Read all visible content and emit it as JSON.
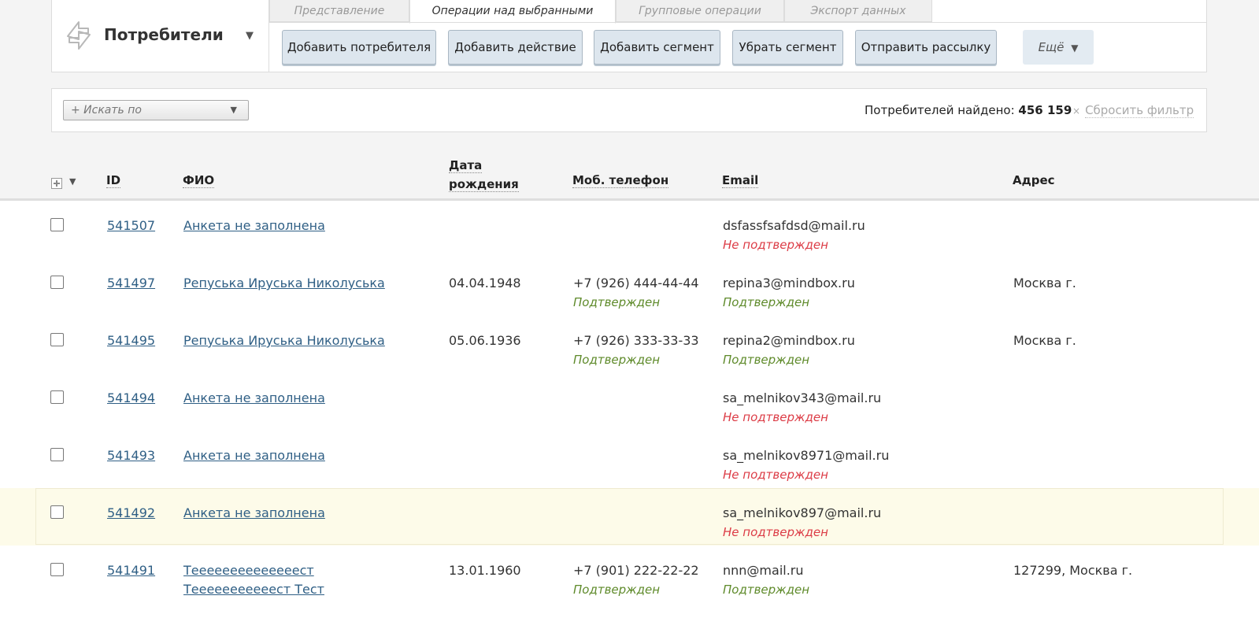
{
  "app": {
    "title": "Потребители"
  },
  "tabs": [
    {
      "label": "Представление",
      "active": false
    },
    {
      "label": "Операции над выбранными",
      "active": true
    },
    {
      "label": "Групповые операции",
      "active": false
    },
    {
      "label": "Экспорт данных",
      "active": false
    }
  ],
  "actions": {
    "add_customer": "Добавить потребителя",
    "add_action": "Добавить действие",
    "add_segment": "Добавить сегмент",
    "remove_segment": "Убрать сегмент",
    "send_mailing": "Отправить рассылку",
    "more": "Ещё"
  },
  "filter": {
    "search_placeholder": "+ Искать по",
    "found_label": "Потребителей найдено:",
    "found_count": "456 159",
    "reset_label": "Сбросить фильтр"
  },
  "columns": {
    "id": "ID",
    "name": "ФИО",
    "birth_line1": "Дата",
    "birth_line2": "рождения",
    "phone": "Моб. телефон",
    "email": "Email",
    "address": "Адрес"
  },
  "rows": [
    {
      "id": "541507",
      "name1": "Анкета не заполнена",
      "name2": "",
      "birth": "",
      "phone": "",
      "phone_status": "",
      "phone_ok": true,
      "email": "dsfassfsafdsd@mail.ru",
      "email_status": "Не подтвержден",
      "email_ok": false,
      "address": "",
      "highlighted": false
    },
    {
      "id": "541497",
      "name1": "Репуська Ируська Николуська",
      "name2": "",
      "birth": "04.04.1948",
      "phone": "+7 (926) 444-44-44",
      "phone_status": "Подтвержден",
      "phone_ok": true,
      "email": "repina3@mindbox.ru",
      "email_status": "Подтвержден",
      "email_ok": true,
      "address": "Москва г.",
      "highlighted": false
    },
    {
      "id": "541495",
      "name1": "Репуська Ируська Николуська",
      "name2": "",
      "birth": "05.06.1936",
      "phone": "+7 (926) 333-33-33",
      "phone_status": "Подтвержден",
      "phone_ok": true,
      "email": "repina2@mindbox.ru",
      "email_status": "Подтвержден",
      "email_ok": true,
      "address": "Москва г.",
      "highlighted": false
    },
    {
      "id": "541494",
      "name1": "Анкета не заполнена",
      "name2": "",
      "birth": "",
      "phone": "",
      "phone_status": "",
      "phone_ok": true,
      "email": "sa_melnikov343@mail.ru",
      "email_status": "Не подтвержден",
      "email_ok": false,
      "address": "",
      "highlighted": false
    },
    {
      "id": "541493",
      "name1": "Анкета не заполнена",
      "name2": "",
      "birth": "",
      "phone": "",
      "phone_status": "",
      "phone_ok": true,
      "email": "sa_melnikov8971@mail.ru",
      "email_status": "Не подтвержден",
      "email_ok": false,
      "address": "",
      "highlighted": false
    },
    {
      "id": "541492",
      "name1": "Анкета не заполнена",
      "name2": "",
      "birth": "",
      "phone": "",
      "phone_status": "",
      "phone_ok": true,
      "email": "sa_melnikov897@mail.ru",
      "email_status": "Не подтвержден",
      "email_ok": false,
      "address": "",
      "highlighted": true
    },
    {
      "id": "541491",
      "name1": "Теееееееееееееест",
      "name2": "Тееееееееееест Тест",
      "birth": "13.01.1960",
      "phone": "+7 (901) 222-22-22",
      "phone_status": "Подтвержден",
      "phone_ok": true,
      "email": "nnn@mail.ru",
      "email_status": "Подтвержден",
      "email_ok": true,
      "address": "127299, Москва г.",
      "highlighted": false
    }
  ],
  "colors": {
    "confirmed": "#5e8a2a",
    "unconfirmed": "#dc3c46",
    "link": "#2f5f85",
    "highlight_row": "#fdfbe9"
  }
}
